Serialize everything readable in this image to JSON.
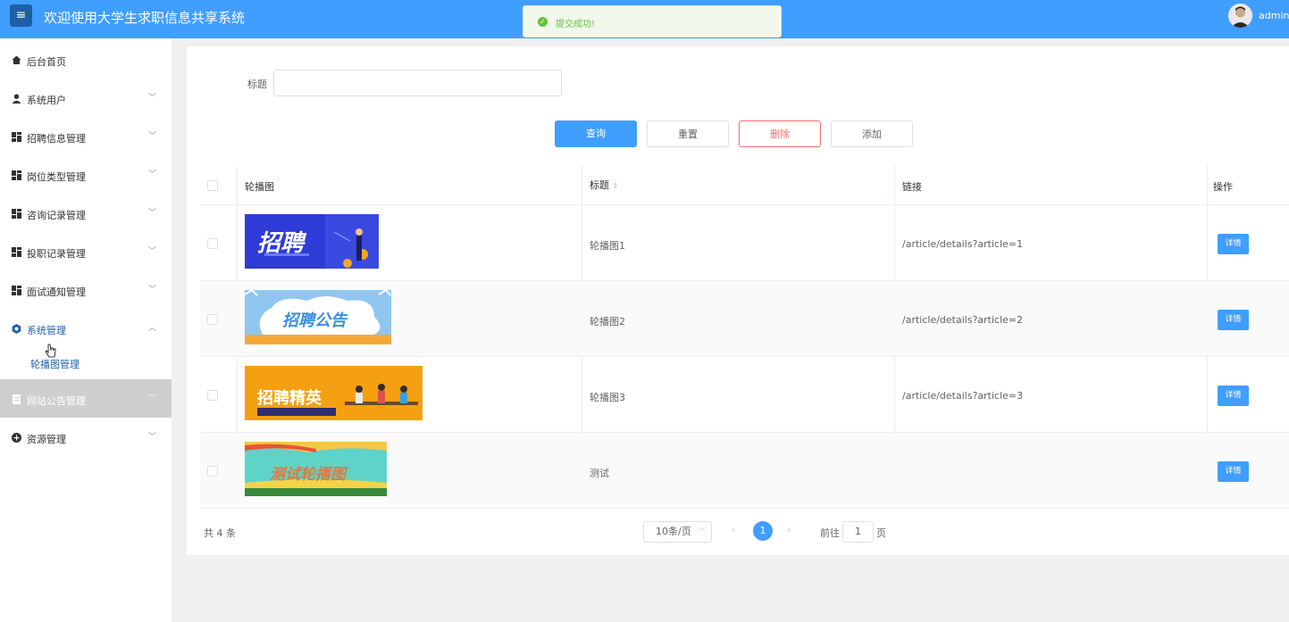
{
  "header": {
    "menu_icon": "menu-icon",
    "title": "欢迎使用大学生求职信息共享系统",
    "user": "admin"
  },
  "toast": {
    "icon": "check-circle-icon",
    "message": "提交成功!"
  },
  "sidebar": {
    "items": [
      {
        "label": "后台首页",
        "icon": "home-icon"
      },
      {
        "label": "系统用户",
        "icon": "user-icon"
      },
      {
        "label": "招聘信息管理",
        "icon": "grid-icon"
      },
      {
        "label": "岗位类型管理",
        "icon": "grid-icon"
      },
      {
        "label": "咨询记录管理",
        "icon": "grid-icon"
      },
      {
        "label": "投职记录管理",
        "icon": "grid-icon"
      },
      {
        "label": "面试通知管理",
        "icon": "grid-icon"
      },
      {
        "label": "系统管理",
        "icon": "gear-icon"
      },
      {
        "label": "网站公告管理",
        "icon": "document-icon"
      },
      {
        "label": "资源管理",
        "icon": "plus-circle-icon"
      }
    ],
    "submenu_active": "轮播图管理"
  },
  "search": {
    "label": "标题",
    "value": "",
    "placeholder": ""
  },
  "buttons": {
    "query": "查询",
    "reset": "重置",
    "delete": "删除",
    "add": "添加"
  },
  "table": {
    "headers": [
      "轮播图",
      "标题",
      "链接",
      "操作"
    ],
    "sort_icon": "sort-caret-icon",
    "rows": [
      {
        "title": "轮播图1",
        "link": "/article/details?article=1",
        "banner_text": "招聘",
        "action": "详情"
      },
      {
        "title": "轮播图2",
        "link": "/article/details?article=2",
        "banner_text": "招聘公告",
        "action": "详情"
      },
      {
        "title": "轮播图3",
        "link": "/article/details?article=3",
        "banner_text": "招聘精英",
        "action": "详情"
      },
      {
        "title": "测试",
        "link": "",
        "banner_text": "测试轮播图",
        "action": "详情"
      }
    ]
  },
  "pagination": {
    "total": "共 4 条",
    "page_size": "10条/页",
    "current_page": "1",
    "goto_label": "前往",
    "goto_value": "1",
    "goto_suffix": "页"
  },
  "colors": {
    "primary": "#409eff",
    "success": "#67c23a",
    "danger": "#f56c6c"
  }
}
